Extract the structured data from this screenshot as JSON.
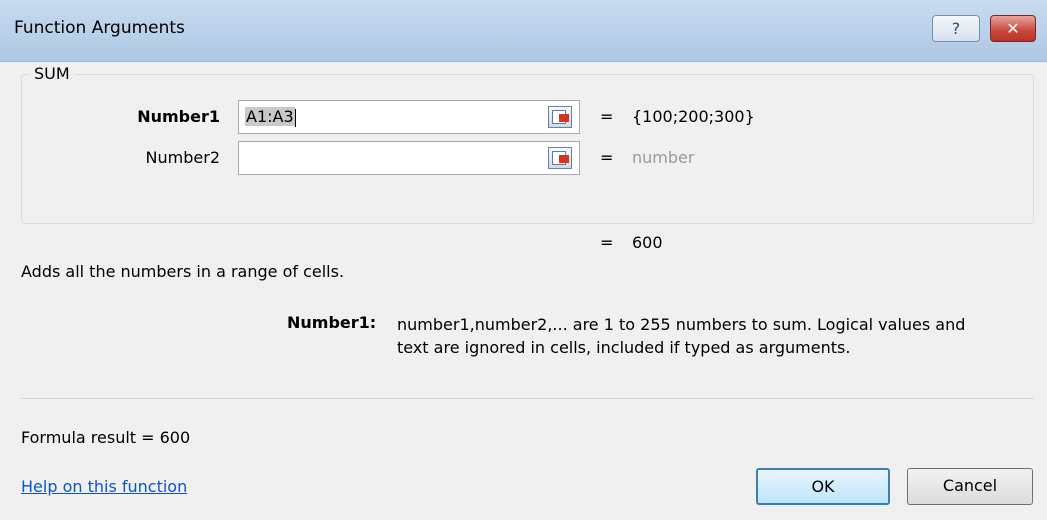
{
  "window": {
    "title": "Function Arguments",
    "help_glyph": "?",
    "close_glyph": "✕"
  },
  "function": {
    "name": "SUM",
    "description": "Adds all the numbers in a range of cells."
  },
  "arguments": [
    {
      "label": "Number1",
      "value": "A1:A3",
      "placeholder": "",
      "eq": "=",
      "evaluated": "{100;200;300}",
      "bold": true
    },
    {
      "label": "Number2",
      "value": "",
      "placeholder": "",
      "eq": "=",
      "evaluated": "number",
      "bold": false
    }
  ],
  "result": {
    "eq": "=",
    "value": "600"
  },
  "help_text": {
    "label": "Number1:",
    "line1": "number1,number2,... are 1 to 255 numbers to sum. Logical values and",
    "line2": "text are ignored in cells, included if typed as arguments."
  },
  "formula_result": "Formula result =   600",
  "help_link": "Help on this function",
  "buttons": {
    "ok": "OK",
    "cancel": "Cancel"
  },
  "icons": {
    "refedit": "collapse-dialog-icon",
    "help": "help-icon",
    "close": "close-icon"
  },
  "colors": {
    "titlebar": "#b9d1ea",
    "close": "#c9473b",
    "link": "#0a56c9",
    "ok_border": "#3c7fb1"
  }
}
